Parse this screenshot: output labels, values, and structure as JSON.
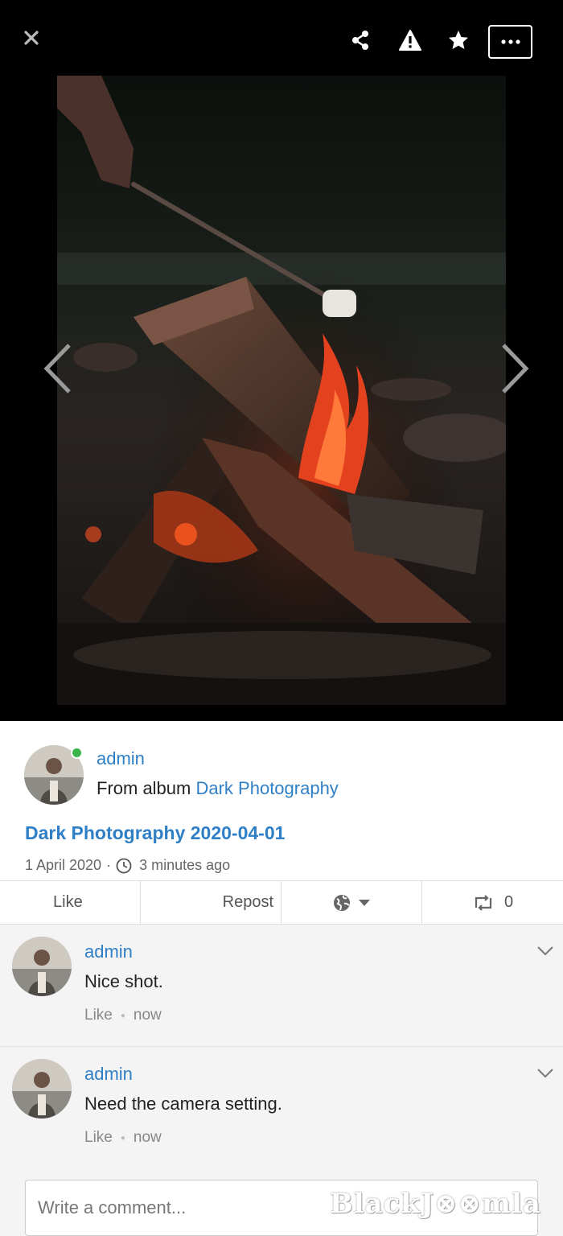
{
  "viewer": {
    "icons": {
      "close": "close-icon",
      "share": "share-icon",
      "report": "warning-icon",
      "favorite": "star-icon",
      "more": "more-icon"
    },
    "photo_alt": "campfire with marshmallow"
  },
  "post": {
    "author": "admin",
    "from_prefix": "From album",
    "album": "Dark Photography",
    "title": "Dark Photography 2020-04-01",
    "date": "1 April 2020",
    "separator": "·",
    "time_ago": "3 minutes ago"
  },
  "actions": {
    "like": "Like",
    "repost": "Repost",
    "privacy_icon": "globe-icon",
    "repost_count": "0"
  },
  "comments": [
    {
      "author": "admin",
      "text": "Nice shot.",
      "like": "Like",
      "time": "now"
    },
    {
      "author": "admin",
      "text": "Need the camera setting.",
      "like": "Like",
      "time": "now"
    }
  ],
  "comment_input": {
    "placeholder": "Write a comment..."
  },
  "watermark": "BlackJ⊗⊗mla",
  "colors": {
    "link": "#2f7fc6",
    "online": "#3ab54a",
    "viewer_bg": "#000000"
  }
}
